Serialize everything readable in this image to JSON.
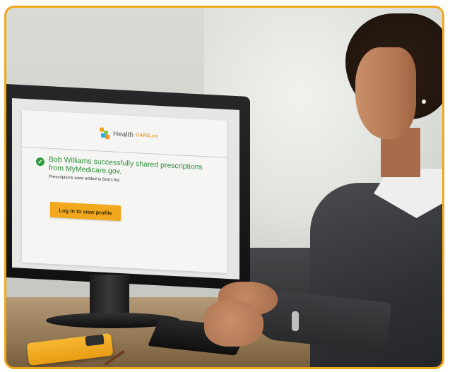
{
  "image": {
    "kind": "photo",
    "frame_color": "#f2a81d"
  },
  "screen": {
    "logo": {
      "name_main": "Health",
      "name_accent": "CARE.co"
    },
    "success_message": "Bob Williams successfully shared prescriptions from MyMedicare.gov.",
    "sub_message": "Prescriptions were added to Bob's list.",
    "login_button_label": "Log in to view profile",
    "colors": {
      "success": "#2f8f3a",
      "button": "#f2a81d"
    },
    "icons": {
      "success": "check-circle-icon"
    }
  }
}
